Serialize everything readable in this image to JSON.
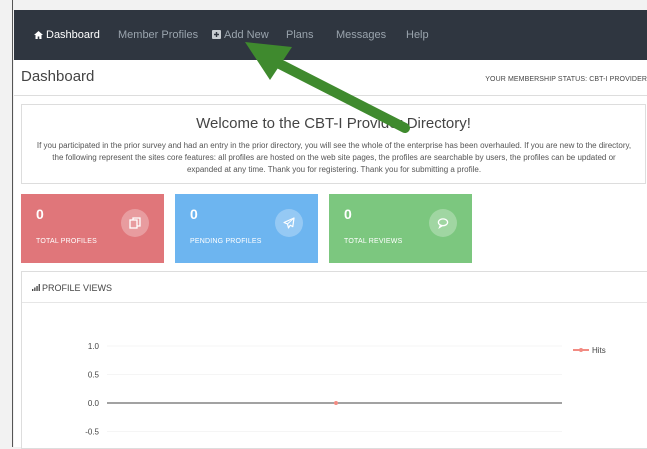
{
  "nav": {
    "items": [
      {
        "label": "Dashboard",
        "icon": "home-icon"
      },
      {
        "label": "Member Profiles"
      },
      {
        "label": "Add New",
        "icon": "plus-square-icon"
      },
      {
        "label": "Plans"
      },
      {
        "label": "Messages"
      },
      {
        "label": "Help"
      }
    ]
  },
  "page": {
    "title": "Dashboard",
    "membership_status": "YOUR MEMBERSHIP STATUS: CBT-I PROVIDER"
  },
  "welcome": {
    "title": "Welcome to the CBT-I Provider Directory!",
    "body": "If you participated in the prior survey and had an entry in the prior directory, you will see the whole of the enterprise has been overhauled. If you are new to the directory, the following represent the sites core features: all profiles are hosted on the web site pages, the profiles are searchable by users, the profiles can be updated or expanded at any time. Thank you for registering. Thank you for submitting a profile."
  },
  "stats": [
    {
      "value": "0",
      "label": "TOTAL PROFILES",
      "icon": "copy-icon",
      "color": "#e0767a"
    },
    {
      "value": "0",
      "label": "PENDING PROFILES",
      "icon": "paper-plane-icon",
      "color": "#6db5f0"
    },
    {
      "value": "0",
      "label": "TOTAL REVIEWS",
      "icon": "chat-icon",
      "color": "#7cc77f"
    }
  ],
  "panel": {
    "title": "PROFILE VIEWS"
  },
  "chart_data": {
    "type": "line",
    "series": [
      {
        "name": "Hits",
        "values": [
          0.0
        ],
        "color": "#f28b82"
      }
    ],
    "yticks": [
      "1.0",
      "0.5",
      "0.0",
      "-0.5"
    ],
    "ylim": [
      -0.5,
      1.0
    ],
    "grid": false,
    "legend": "right"
  },
  "annotation": {
    "color": "#3f8a2e",
    "icon": "arrow-pointer"
  }
}
